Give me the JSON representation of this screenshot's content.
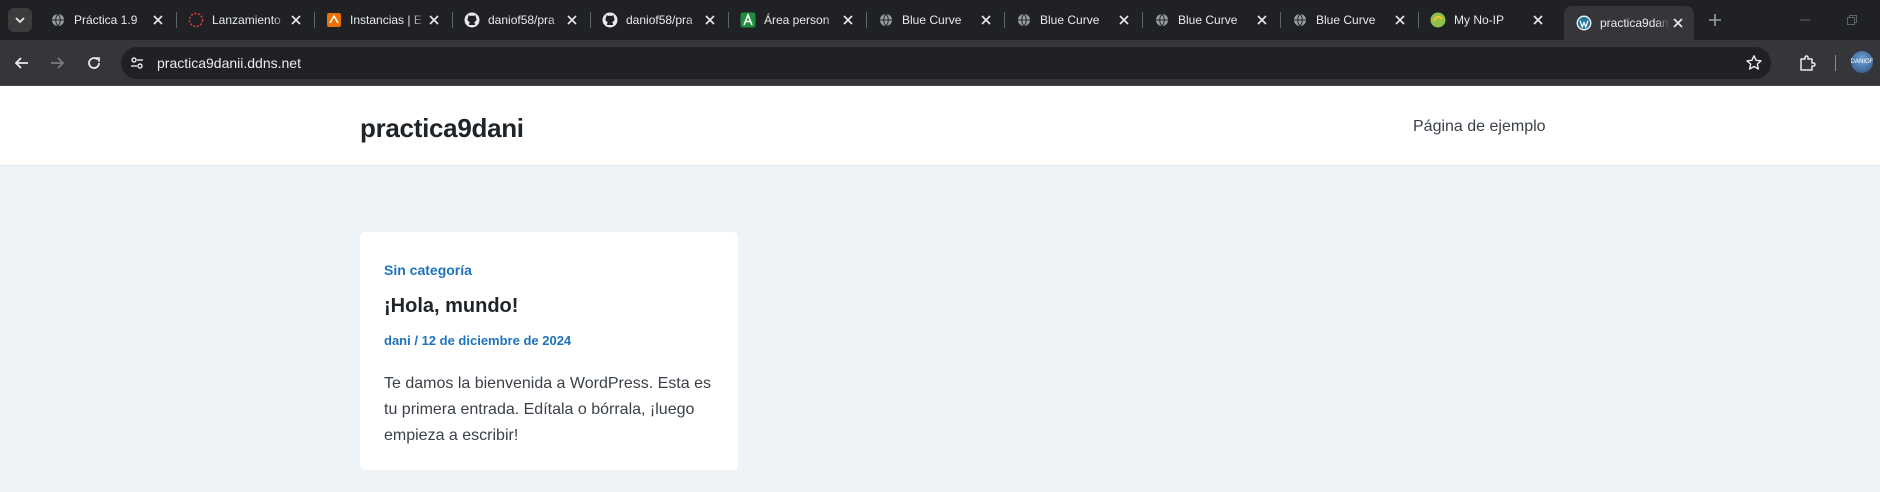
{
  "browser": {
    "tabs": [
      {
        "title": "Práctica 1.9",
        "favicon": "globe-icon",
        "active": false
      },
      {
        "title": "Lanzamiento",
        "favicon": "loading-spinner-icon",
        "active": false
      },
      {
        "title": "Instancias | E",
        "favicon": "aws-icon",
        "active": false
      },
      {
        "title": "daniof58/pra",
        "favicon": "github-icon",
        "active": false
      },
      {
        "title": "daniof58/pra",
        "favicon": "github-icon",
        "active": false
      },
      {
        "title": "Área person",
        "favicon": "a-logo-icon",
        "active": false
      },
      {
        "title": "Blue Curve",
        "favicon": "globe-icon",
        "active": false
      },
      {
        "title": "Blue Curve",
        "favicon": "globe-icon",
        "active": false
      },
      {
        "title": "Blue Curve",
        "favicon": "globe-icon",
        "active": false
      },
      {
        "title": "Blue Curve",
        "favicon": "globe-icon",
        "active": false
      },
      {
        "title": "My No-IP",
        "favicon": "noip-icon",
        "active": false
      },
      {
        "title": "practica9dan",
        "favicon": "wordpress-icon",
        "active": true
      }
    ],
    "url": "practica9danii.ddns.net",
    "profile_label": "DANIOF"
  },
  "site": {
    "title": "practica9dani",
    "nav_link": "Página de ejemplo"
  },
  "post": {
    "category": "Sin categoría",
    "title": "¡Hola, mundo!",
    "author": "dani",
    "separator": " / ",
    "date": "12 de diciembre de 2024",
    "excerpt": "Te damos la bienvenida a WordPress. Esta es tu primera entrada. Edítala o bórrala, ¡luego empieza a escribir!"
  },
  "colors": {
    "accent": "#1e73be",
    "page_bg": "#eef3f7",
    "tabstrip_bg": "#202124",
    "toolbar_bg": "#35363a"
  }
}
